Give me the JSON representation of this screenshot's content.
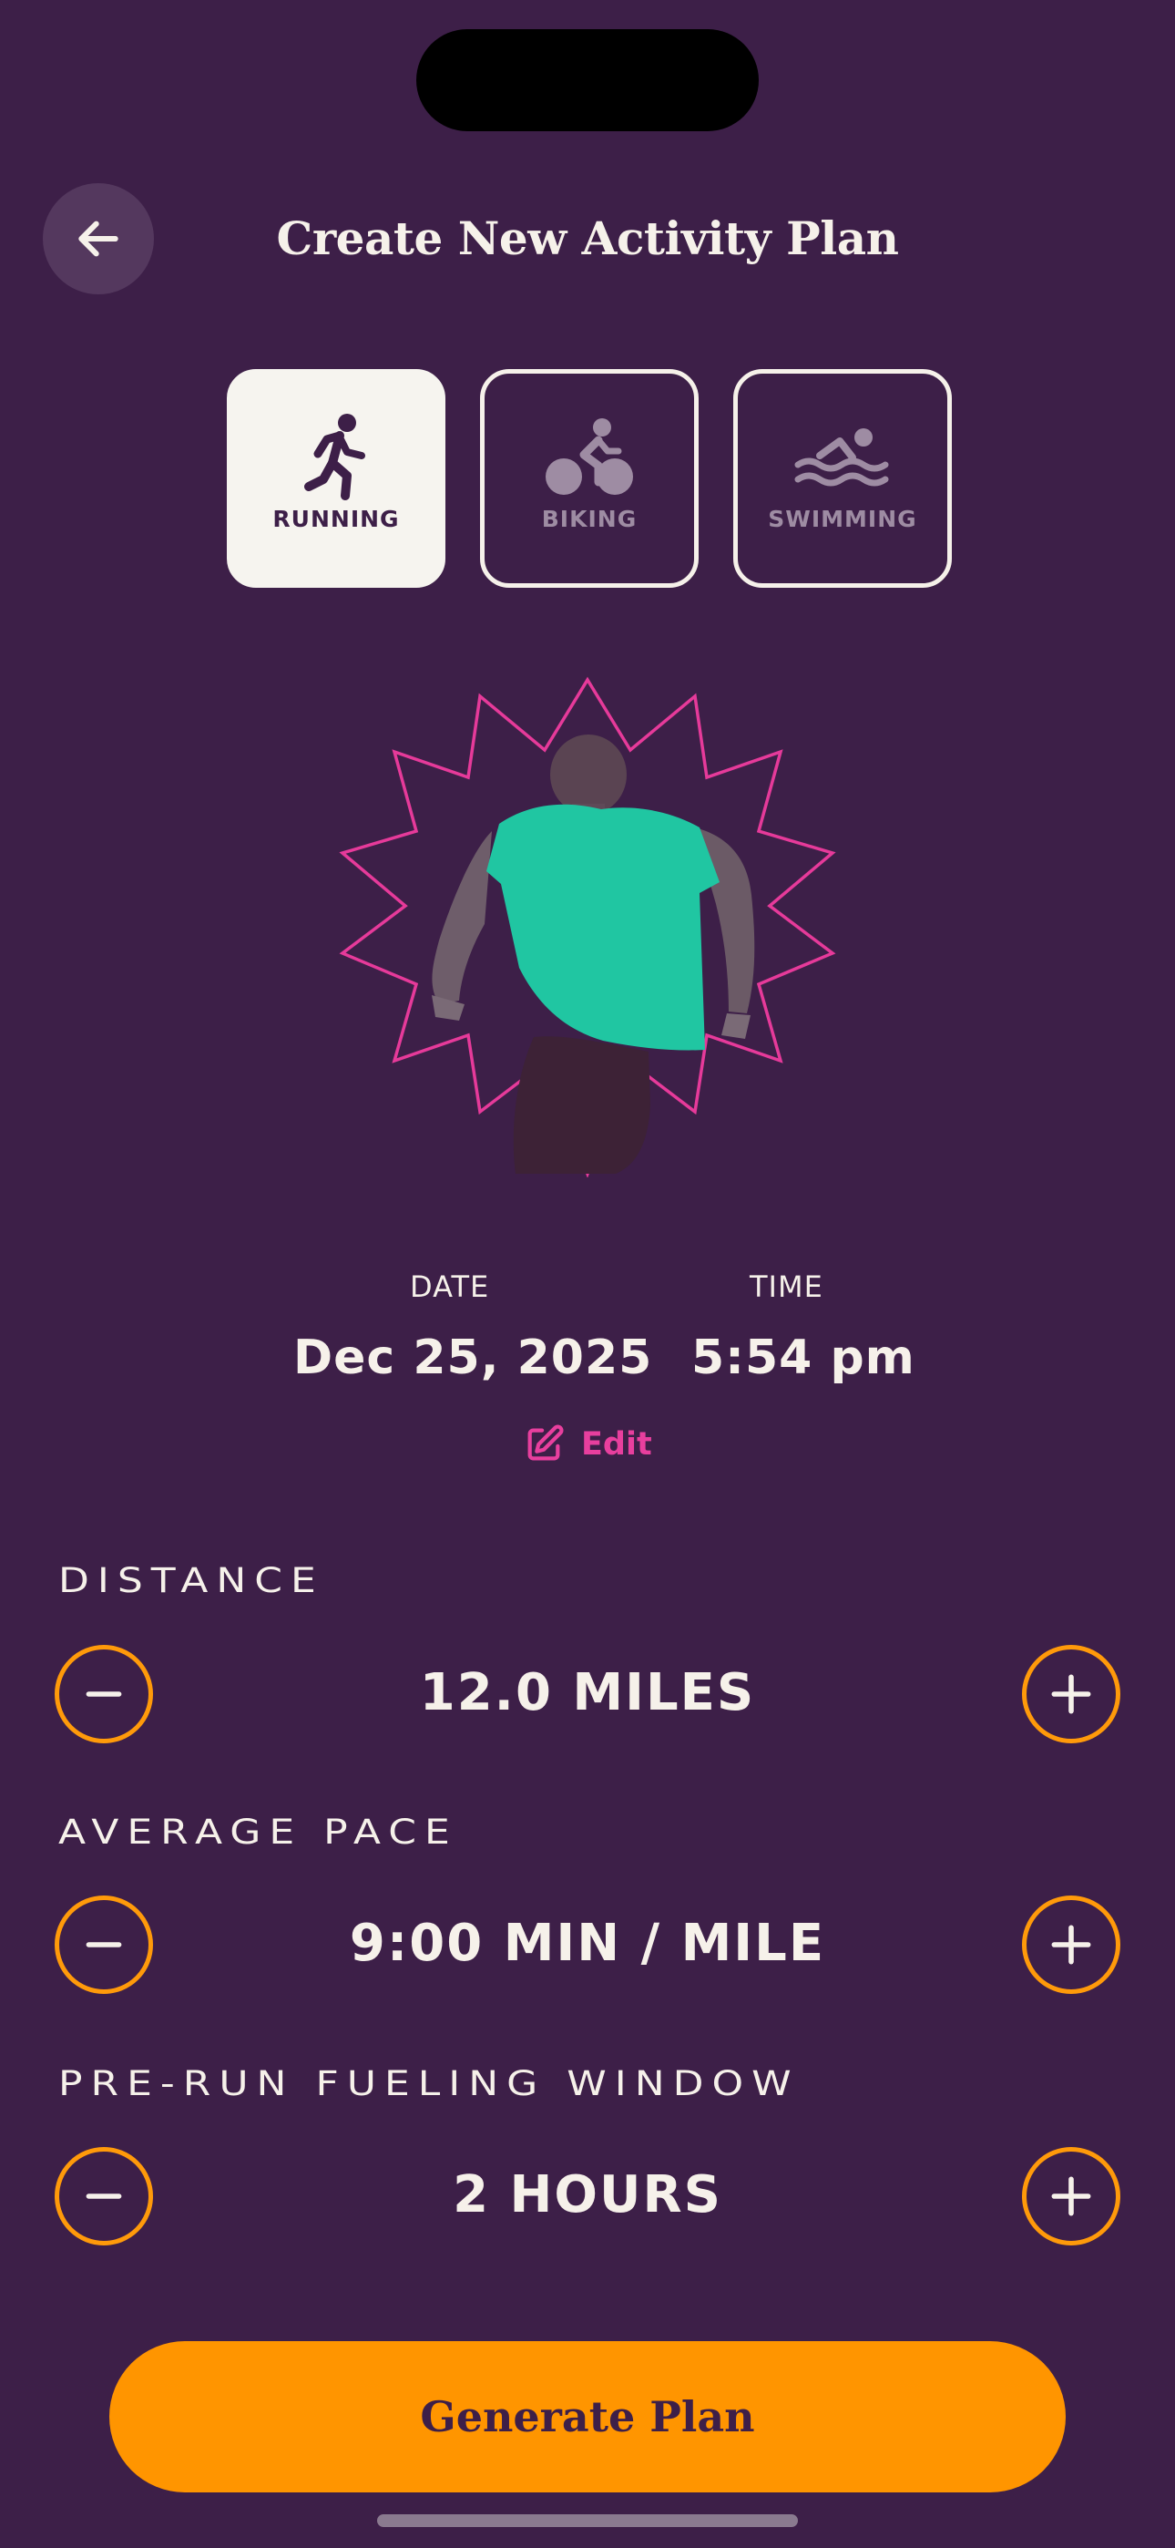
{
  "header": {
    "title": "Create New Activity Plan",
    "back_icon": "arrow-left-icon"
  },
  "activities": [
    {
      "label": "RUNNING",
      "icon": "running-icon",
      "selected": true
    },
    {
      "label": "BIKING",
      "icon": "biking-icon",
      "selected": false
    },
    {
      "label": "SWIMMING",
      "icon": "swimming-icon",
      "selected": false
    }
  ],
  "schedule": {
    "date_label": "DATE",
    "date_value": "Dec 25, 2025",
    "time_label": "TIME",
    "time_value": "5:54 pm",
    "edit_label": "Edit",
    "edit_icon": "edit-pencil-icon"
  },
  "settings": {
    "distance": {
      "label": "DISTANCE",
      "value": "12.0 MILES"
    },
    "pace": {
      "label": "AVERAGE PACE",
      "value": "9:00 MIN / MILE"
    },
    "fueling": {
      "label": "PRE-RUN FUELING WINDOW",
      "value": "2 HOURS"
    }
  },
  "actions": {
    "generate_label": "Generate Plan"
  },
  "colors": {
    "background": "#3d1f48",
    "accent_orange": "#ff9500",
    "accent_pink": "#e83f9e",
    "selected_tile": "#f6f4ef",
    "text": "#f6f1ea"
  }
}
